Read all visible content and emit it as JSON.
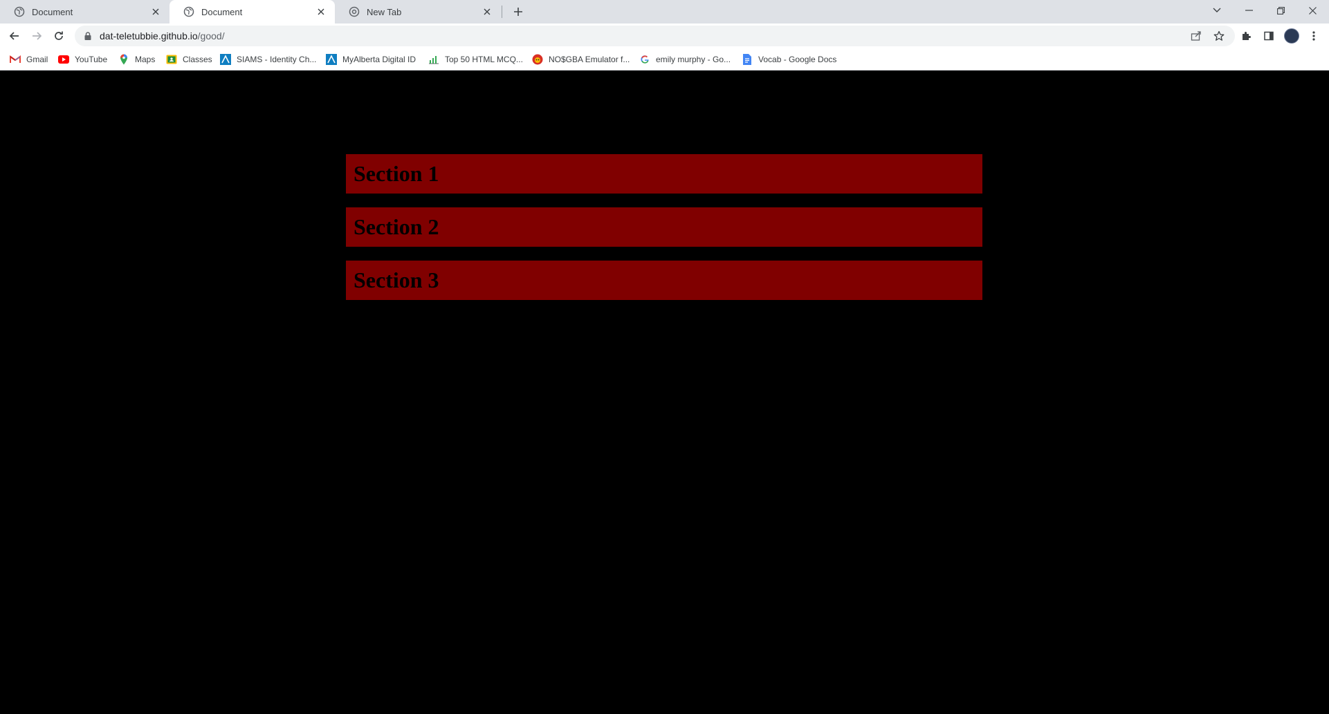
{
  "browser": {
    "tabs": [
      {
        "title": "Document",
        "active": false
      },
      {
        "title": "Document",
        "active": true
      },
      {
        "title": "New Tab",
        "active": false
      }
    ],
    "address": {
      "host": "dat-teletubbie.github.io",
      "path": "/good/"
    },
    "bookmarks": [
      {
        "label": "Gmail",
        "icon": "gmail-icon"
      },
      {
        "label": "YouTube",
        "icon": "youtube-icon"
      },
      {
        "label": "Maps",
        "icon": "maps-icon"
      },
      {
        "label": "Classes",
        "icon": "classroom-icon"
      },
      {
        "label": "SIAMS - Identity Ch...",
        "icon": "siams-icon"
      },
      {
        "label": "MyAlberta Digital ID",
        "icon": "myalberta-icon"
      },
      {
        "label": "Top 50 HTML MCQ...",
        "icon": "chart-icon"
      },
      {
        "label": "NO$GBA Emulator f...",
        "icon": "emulator-icon"
      },
      {
        "label": "emily murphy - Go...",
        "icon": "google-icon"
      },
      {
        "label": "Vocab - Google Docs",
        "icon": "docs-icon"
      }
    ]
  },
  "page": {
    "background": "#000000",
    "section_color": "#800000",
    "sections": [
      {
        "title": "Section 1"
      },
      {
        "title": "Section 2"
      },
      {
        "title": "Section 3"
      }
    ]
  }
}
